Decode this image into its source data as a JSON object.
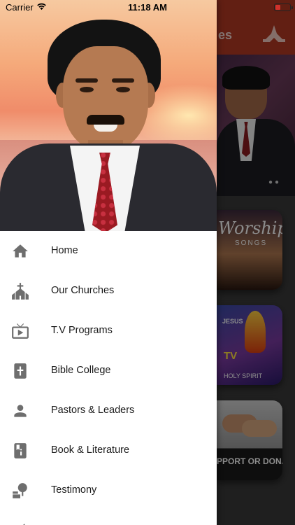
{
  "status_bar": {
    "carrier": "Carrier",
    "time": "11:18 AM",
    "battery_level": 0.35,
    "battery_color": "#d0322c"
  },
  "background_app": {
    "title_partial": "es",
    "appbar_color": "#b33a24",
    "cards": [
      {
        "title": "Worship",
        "subtitle": "SONGS"
      },
      {
        "title": "JESUS",
        "subtitle": "HOLY SPIRIT",
        "tv_text": "TV"
      },
      {
        "title": "PPORT OR DONATE"
      }
    ]
  },
  "drawer": {
    "menu_items": [
      {
        "label": "Home",
        "icon": "home-icon"
      },
      {
        "label": "Our Churches",
        "icon": "church-icon"
      },
      {
        "label": "T.V Programs",
        "icon": "tv-icon"
      },
      {
        "label": "Bible College",
        "icon": "bible-icon"
      },
      {
        "label": "Pastors & Leaders",
        "icon": "pastor-icon"
      },
      {
        "label": "Book & Literature",
        "icon": "book-icon"
      },
      {
        "label": "Testimony",
        "icon": "testimony-icon"
      }
    ],
    "icon_color": "#6e6e6e"
  }
}
